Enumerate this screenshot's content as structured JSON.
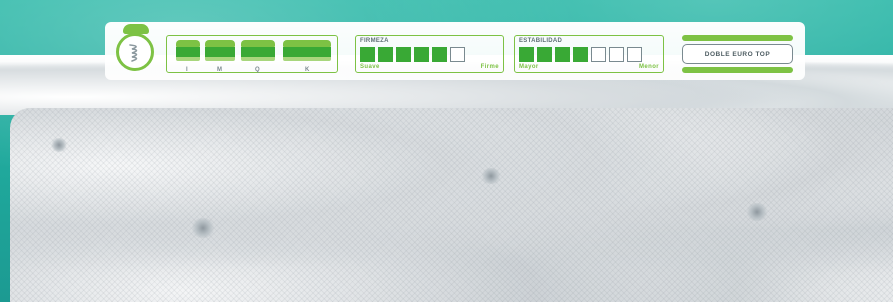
{
  "colors": {
    "brand_green": "#7dc244",
    "dark_green": "#39a935",
    "teal_background": "#2fb6a7",
    "outline_gray": "#7a8a90"
  },
  "spring_badge": {
    "icon": "spring-coil-icon"
  },
  "sizes": {
    "labels": [
      "I",
      "M",
      "Q",
      "K"
    ],
    "icon": "mattress-icon"
  },
  "firmness": {
    "title": "FIRMEZA",
    "low_label": "Suave",
    "high_label": "Firme",
    "level": 5,
    "max": 6
  },
  "stability": {
    "title": "ESTABILIDAD",
    "low_label": "Mayor",
    "high_label": "Menor",
    "level": 4,
    "max": 7
  },
  "model": {
    "label": "DOBLE EURO TOP"
  }
}
